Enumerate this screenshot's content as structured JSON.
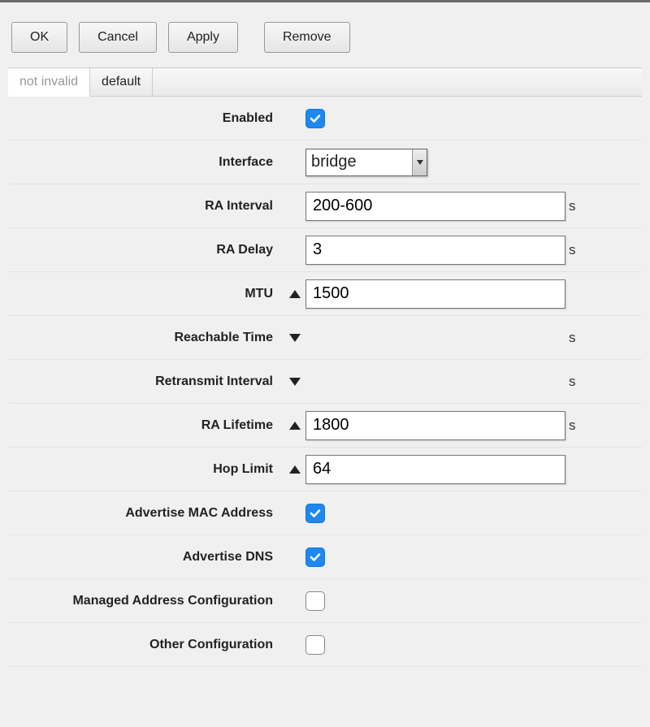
{
  "buttons": {
    "ok": "OK",
    "cancel": "Cancel",
    "apply": "Apply",
    "remove": "Remove"
  },
  "tabs": {
    "tab1": "not invalid",
    "tab2": "default",
    "active": "tab1"
  },
  "fields": {
    "enabled": {
      "label": "Enabled",
      "checked": true
    },
    "interface": {
      "label": "Interface",
      "value": "bridge"
    },
    "ra_interval": {
      "label": "RA Interval",
      "value": "200-600",
      "unit": "s"
    },
    "ra_delay": {
      "label": "RA Delay",
      "value": "3",
      "unit": "s"
    },
    "mtu": {
      "label": "MTU",
      "value": "1500",
      "expanded": true
    },
    "reachable_time": {
      "label": "Reachable Time",
      "unit": "s",
      "expanded": false
    },
    "retransmit_interval": {
      "label": "Retransmit Interval",
      "unit": "s",
      "expanded": false
    },
    "ra_lifetime": {
      "label": "RA Lifetime",
      "value": "1800",
      "unit": "s",
      "expanded": true
    },
    "hop_limit": {
      "label": "Hop Limit",
      "value": "64",
      "expanded": true
    },
    "advertise_mac": {
      "label": "Advertise MAC Address",
      "checked": true
    },
    "advertise_dns": {
      "label": "Advertise DNS",
      "checked": true
    },
    "managed_addr": {
      "label": "Managed Address Configuration",
      "checked": false
    },
    "other_conf": {
      "label": "Other Configuration",
      "checked": false
    }
  }
}
